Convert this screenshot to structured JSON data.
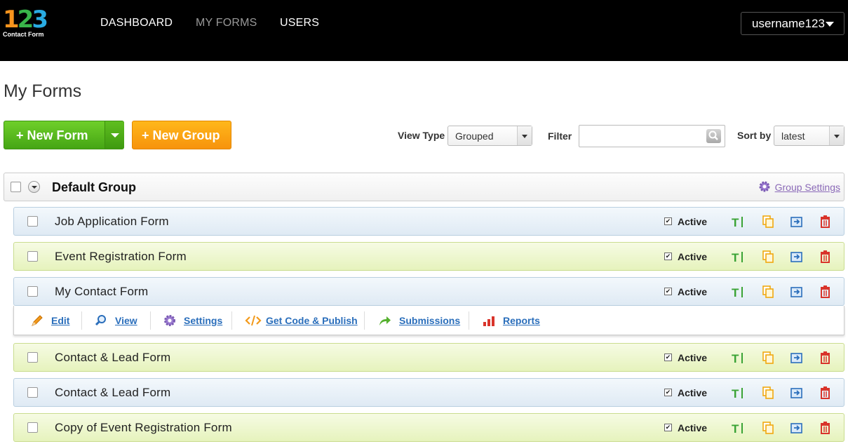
{
  "header": {
    "logo_digits": "123",
    "logo_sub": "Contact Form",
    "nav": [
      "DASHBOARD",
      "MY FORMS",
      "USERS"
    ],
    "username": "username123"
  },
  "page_title": "My Forms",
  "toolbar": {
    "new_form": "+ New Form",
    "new_group": "+ New Group",
    "view_type_label": "View Type",
    "view_type_value": "Grouped",
    "filter_label": "Filter",
    "filter_value": "",
    "sort_label": "Sort by",
    "sort_value": "latest"
  },
  "group": {
    "title": "Default Group",
    "settings_label": "Group Settings"
  },
  "forms": [
    {
      "title": "Job Application Form",
      "status": "Active",
      "checkbox_mark": "✔"
    },
    {
      "title": "Event Registration Form",
      "status": "Active",
      "checkbox_mark": "✔"
    },
    {
      "title": "My Contact Form",
      "status": "Active",
      "checkbox_mark": "✔"
    },
    {
      "title": "Contact & Lead Form",
      "status": "Active",
      "checkbox_mark": "✔"
    },
    {
      "title": "Contact & Lead Form",
      "status": "Active",
      "checkbox_mark": "✔"
    },
    {
      "title": "Copy of Event Registration Form",
      "status": "Active",
      "checkbox_mark": "✔"
    }
  ],
  "actions": {
    "edit": "Edit",
    "view": "View",
    "settings": "Settings",
    "code": "Get Code & Publish",
    "submissions": "Submissions",
    "reports": "Reports"
  },
  "colors": {
    "green": "#45a514",
    "orange": "#f7930c",
    "link": "#2a6ebb"
  }
}
